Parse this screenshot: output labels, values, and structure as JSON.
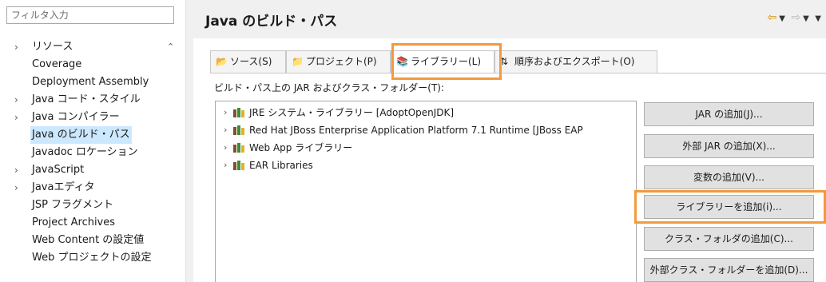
{
  "filter": {
    "placeholder": "フィルタ入力"
  },
  "sidebar": {
    "items": [
      {
        "label": "リソース",
        "expandable": true
      },
      {
        "label": "Coverage",
        "expandable": false
      },
      {
        "label": "Deployment Assembly",
        "expandable": false
      },
      {
        "label": "Java コード・スタイル",
        "expandable": true
      },
      {
        "label": "Java コンパイラー",
        "expandable": true
      },
      {
        "label": "Java のビルド・パス",
        "expandable": false,
        "selected": true
      },
      {
        "label": "Javadoc ロケーション",
        "expandable": false
      },
      {
        "label": "JavaScript",
        "expandable": true
      },
      {
        "label": "Javaエディタ",
        "expandable": true
      },
      {
        "label": "JSP フラグメント",
        "expandable": false
      },
      {
        "label": "Project Archives",
        "expandable": false
      },
      {
        "label": "Web Content の設定値",
        "expandable": false
      },
      {
        "label": "Web プロジェクトの設定",
        "expandable": false
      }
    ]
  },
  "header": {
    "title": "Java のビルド・パス"
  },
  "tabs": [
    {
      "label": "ソース(S)",
      "icon": "source-folder-icon"
    },
    {
      "label": "プロジェクト(P)",
      "icon": "project-folder-icon"
    },
    {
      "label": "ライブラリー(L)",
      "icon": "library-icon",
      "active": true
    },
    {
      "label": "順序およびエクスポート(O)",
      "icon": "order-export-icon"
    }
  ],
  "main": {
    "section_label": "ビルド・パス上の JAR およびクラス・フォルダー(T):",
    "libraries": [
      "JRE システム・ライブラリー [AdoptOpenJDK]",
      "Red Hat JBoss Enterprise Application Platform 7.1 Runtime [JBoss EAP",
      "Web App ライブラリー",
      "EAR Libraries"
    ],
    "buttons": [
      "JAR の追加(J)...",
      "外部 JAR の追加(X)...",
      "変数の追加(V)...",
      "ライブラリーを追加(i)...",
      "クラス・フォルダの追加(C)...",
      "外部クラス・フォルダーを追加(D)..."
    ]
  },
  "colors": {
    "highlight": "#f39a3d",
    "selection": "#cce8ff",
    "nav_arrow": "#d49000"
  }
}
